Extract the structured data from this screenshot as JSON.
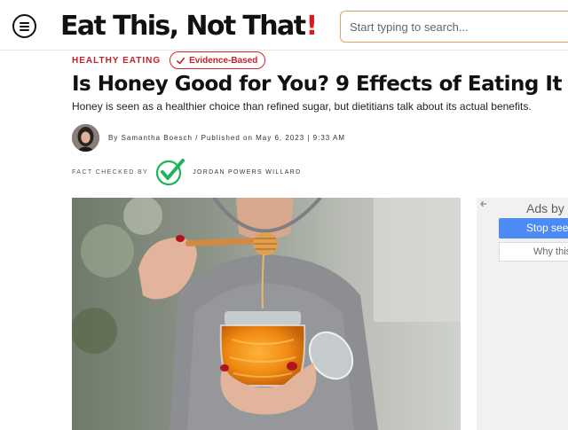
{
  "header": {
    "logo_text": "Eat This, Not That",
    "logo_mark": "!",
    "search_placeholder": "Start typing to search..."
  },
  "article": {
    "category": "HEALTHY EATING",
    "badge": "Evidence-Based",
    "title": "Is Honey Good for You? 9 Effects of Eating It",
    "subtitle": "Honey is seen as a healthier choice than refined sugar, but dietitians talk about its actual benefits.",
    "byline_prefix": "By",
    "author": "Samantha Boesch",
    "byline_rest": "/  Published on May 6, 2023 | 9:33 AM",
    "fact_checked_label": "FACT CHECKED BY",
    "fact_checker": "JORDAN POWERS WILLARD"
  },
  "ad": {
    "ads_by": "Ads by G",
    "stop_label": "Stop seeing",
    "why_label": "Why this"
  },
  "colors": {
    "brand_red": "#e0161e",
    "category_red": "#c4202a",
    "search_border": "#e7a15e",
    "check_green": "#1fb35a",
    "ad_blue": "#4c8bf5"
  },
  "icons": [
    "menu-icon",
    "check-icon",
    "fact-check-icon",
    "back-arrow-icon"
  ]
}
